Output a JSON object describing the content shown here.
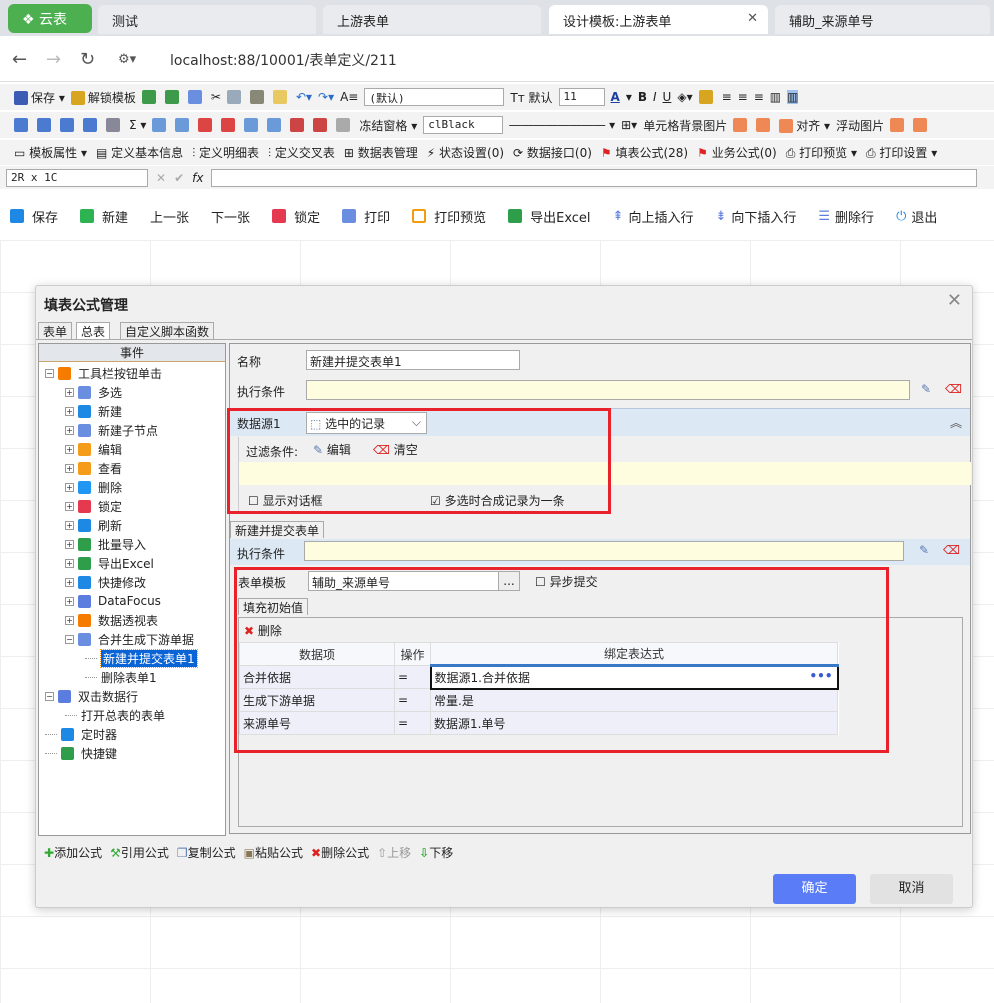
{
  "browser": {
    "logo": "云表",
    "tabs": [
      "测试",
      "上游表单",
      "设计模板:上游表单",
      "辅助_来源单号"
    ],
    "active_tab": 2,
    "url": "localhost:88/10001/表单定义/211"
  },
  "toolbar1": {
    "save": "保存",
    "unlock": "解锁模板",
    "font": "(默认)",
    "default_label": "默认",
    "size": "11"
  },
  "toolbar2": {
    "freeze": "冻结窗格",
    "color": "clBlack",
    "cell_bg": "单元格背景图片",
    "align": "对齐",
    "float_img": "浮动图片"
  },
  "toolbar3": [
    "模板属性",
    "定义基本信息",
    "定义明细表",
    "定义交叉表",
    "数据表管理",
    "状态设置(0)",
    "数据接口(0)",
    "填表公式(28)",
    "业务公式(0)",
    "打印预览",
    "打印设置"
  ],
  "formula_bar": {
    "cell_ref": "2R x 1C",
    "fx": "fx"
  },
  "actions": [
    "保存",
    "新建",
    "上一张",
    "下一张",
    "锁定",
    "打印",
    "打印预览",
    "导出Excel",
    "向上插入行",
    "向下插入行",
    "删除行",
    "退出"
  ],
  "dialog": {
    "title": "填表公式管理",
    "tabs": [
      "表单",
      "总表",
      "自定义脚本函数"
    ],
    "active_tab": 1,
    "tree_header": "事件",
    "tree": [
      {
        "label": "工具栏按钮单击",
        "level": 0,
        "exp": "-",
        "icon": "tools-icon",
        "color": "#f57c00"
      },
      {
        "label": "多选",
        "level": 1,
        "exp": "+",
        "icon": "button-icon",
        "color": "#6a8fe0"
      },
      {
        "label": "新建",
        "level": 1,
        "exp": "+",
        "icon": "plus-icon",
        "color": "#1e88e5"
      },
      {
        "label": "新建子节点",
        "level": 1,
        "exp": "+",
        "icon": "button-icon",
        "color": "#6a8fe0"
      },
      {
        "label": "编辑",
        "level": 1,
        "exp": "+",
        "icon": "folder-icon",
        "color": "#f59c1a"
      },
      {
        "label": "查看",
        "level": 1,
        "exp": "+",
        "icon": "folder-icon",
        "color": "#f59c1a"
      },
      {
        "label": "删除",
        "level": 1,
        "exp": "+",
        "icon": "delete-icon",
        "color": "#2196f3"
      },
      {
        "label": "锁定",
        "level": 1,
        "exp": "+",
        "icon": "lock-icon",
        "color": "#e53950"
      },
      {
        "label": "刷新",
        "level": 1,
        "exp": "+",
        "icon": "refresh-icon",
        "color": "#1e88e5"
      },
      {
        "label": "批量导入",
        "level": 1,
        "exp": "+",
        "icon": "import-icon",
        "color": "#2e9e4a"
      },
      {
        "label": "导出Excel",
        "level": 1,
        "exp": "+",
        "icon": "excel-icon",
        "color": "#2e9e4a"
      },
      {
        "label": "快捷修改",
        "level": 1,
        "exp": "+",
        "icon": "pencil-icon",
        "color": "#1e88e5"
      },
      {
        "label": "DataFocus",
        "level": 1,
        "exp": "+",
        "icon": "chart-icon",
        "color": "#5b7de0"
      },
      {
        "label": "数据透视表",
        "level": 1,
        "exp": "+",
        "icon": "pivot-icon",
        "color": "#f57c00"
      },
      {
        "label": "合并生成下游单据",
        "level": 1,
        "exp": "-",
        "icon": "button-icon",
        "color": "#6a8fe0"
      },
      {
        "label": "新建并提交表单1",
        "level": 2,
        "exp": "",
        "icon": "",
        "color": "",
        "selected": true
      },
      {
        "label": "删除表单1",
        "level": 2,
        "exp": "",
        "icon": "",
        "color": ""
      },
      {
        "label": "双击数据行",
        "level": 0,
        "exp": "-",
        "icon": "dblclick-icon",
        "color": "#5b7de0"
      },
      {
        "label": "打开总表的表单",
        "level": 1,
        "exp": "",
        "icon": "",
        "color": ""
      },
      {
        "label": "定时器",
        "level": 0,
        "exp": "",
        "icon": "timer-icon",
        "color": "#1e88e5"
      },
      {
        "label": "快捷键",
        "level": 0,
        "exp": "",
        "icon": "share-icon",
        "color": "#2e9e4a"
      }
    ],
    "name_label": "名称",
    "name_value": "新建并提交表单1",
    "cond_label": "执行条件",
    "datasource_label": "数据源1",
    "datasource_value": "选中的记录",
    "filter_label": "过滤条件:",
    "edit": "编辑",
    "clear": "清空",
    "show_dialog": "显示对话框",
    "show_dialog_checked": false,
    "merge_label": "多选时合成记录为一条",
    "merge_checked": true,
    "action_tab": "新建并提交表单",
    "cond2_label": "执行条件",
    "form_template_label": "表单模板",
    "form_template_value": "辅助_来源单号",
    "browse": "...",
    "async_label": "异步提交",
    "async_checked": false,
    "fill_tab": "填充初始值",
    "delete": "删除",
    "columns": [
      "数据项",
      "操作",
      "绑定表达式"
    ],
    "rows": [
      [
        "合并依据",
        "=",
        "数据源1.合并依据"
      ],
      [
        "生成下游单据",
        "=",
        "常量.是"
      ],
      [
        "来源单号",
        "=",
        "数据源1.单号"
      ]
    ],
    "more": "•••",
    "bottom": [
      "添加公式",
      "引用公式",
      "复制公式",
      "粘贴公式",
      "删除公式",
      "上移",
      "下移"
    ],
    "ok": "确定",
    "cancel": "取消"
  },
  "colors": {
    "accent": "#5b7cf7",
    "highlight": "#e8212b",
    "yellow": "#fffde0"
  }
}
